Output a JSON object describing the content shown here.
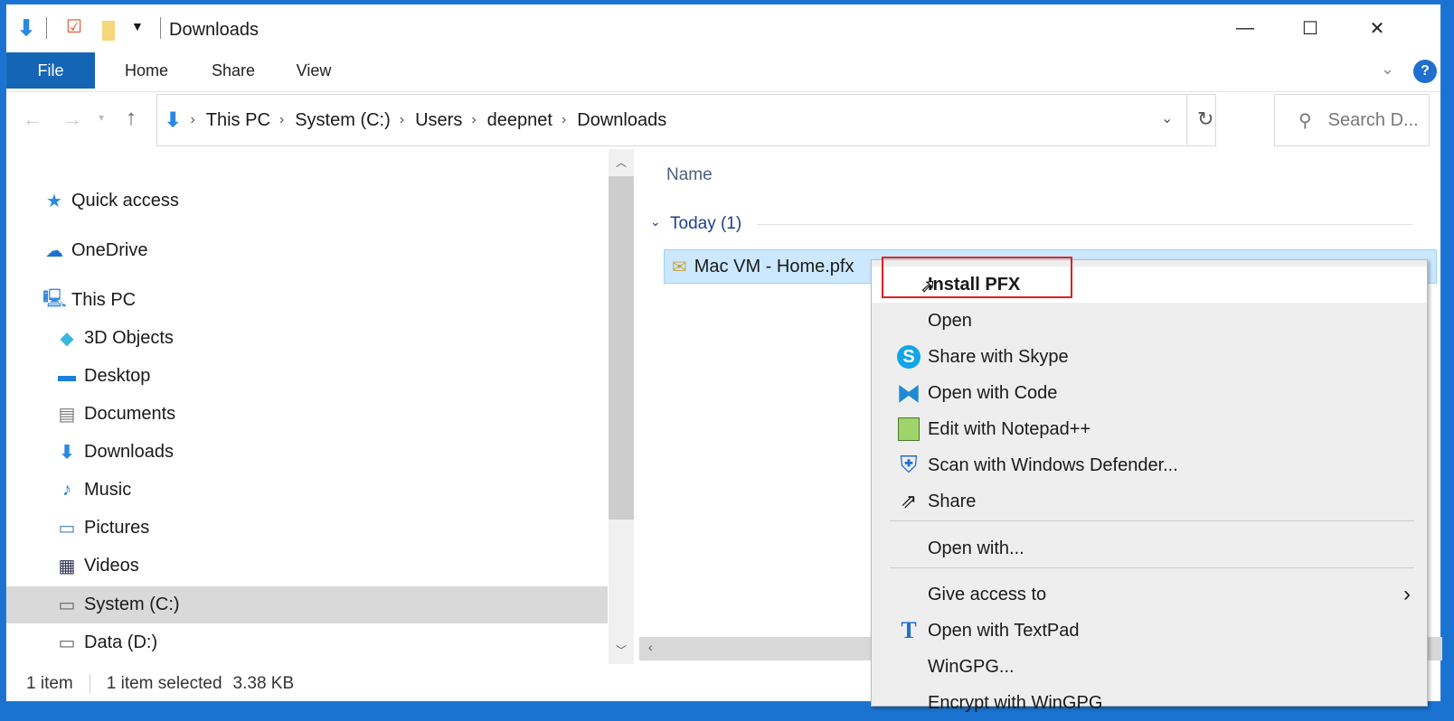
{
  "window": {
    "title": "Downloads",
    "minimize": "—",
    "maximize": "☐",
    "close": "✕"
  },
  "ribbon": {
    "tabs": [
      "File",
      "Home",
      "Share",
      "View"
    ],
    "help": "?"
  },
  "address": {
    "crumbs": [
      "This PC",
      "System (C:)",
      "Users",
      "deepnet",
      "Downloads"
    ],
    "search_placeholder": "Search D..."
  },
  "nav": {
    "items": [
      {
        "label": "Quick access",
        "icon": "star-icon"
      },
      {
        "label": "OneDrive",
        "icon": "cloud-icon"
      },
      {
        "label": "This PC",
        "icon": "computer-icon"
      },
      {
        "label": "3D Objects",
        "icon": "cube-icon"
      },
      {
        "label": "Desktop",
        "icon": "desktop-icon"
      },
      {
        "label": "Documents",
        "icon": "document-icon"
      },
      {
        "label": "Downloads",
        "icon": "download-icon"
      },
      {
        "label": "Music",
        "icon": "music-icon"
      },
      {
        "label": "Pictures",
        "icon": "pictures-icon"
      },
      {
        "label": "Videos",
        "icon": "videos-icon"
      },
      {
        "label": "System (C:)",
        "icon": "drive-icon"
      },
      {
        "label": "Data (D:)",
        "icon": "drive-icon"
      }
    ]
  },
  "content": {
    "column_name": "Name",
    "group": "Today (1)",
    "file": "Mac VM - Home.pfx"
  },
  "context_menu": {
    "items": [
      "Install PFX",
      "Open",
      "Share with Skype",
      "Open with Code",
      "Edit with Notepad++",
      "Scan with Windows Defender...",
      "Share",
      "Open with...",
      "Give access to",
      "Open with TextPad",
      "WinGPG...",
      "Encrypt with WinGPG"
    ]
  },
  "status": {
    "count": "1 item",
    "selected": "1 item selected",
    "size": "3.38 KB"
  },
  "colors": {
    "accent": "#1565b7",
    "highlight": "#cce8ff",
    "red_box": "#e02020"
  }
}
